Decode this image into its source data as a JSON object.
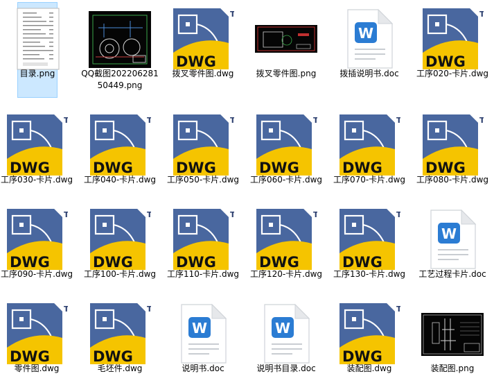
{
  "colors": {
    "background": "#ffffff",
    "selection": "#cce8ff",
    "dwg_navy": "#2b3e6e",
    "dwg_blue": "#4f6fa8",
    "dwg_yellow": "#f5c400",
    "word_blue": "#2b7cd3"
  },
  "dwg_badge": {
    "text": "DWG",
    "tm": "TM"
  },
  "word_badge": {
    "letter": "W"
  },
  "files": [
    {
      "name": "目录.png",
      "icon": "image-thumbnail-icon",
      "kind": "png-doc",
      "selected": true
    },
    {
      "name": "QQ截图20220628150449.png",
      "icon": "image-thumbnail-icon",
      "kind": "png-cad-dark"
    },
    {
      "name": "拨叉零件图.dwg",
      "icon": "dwg-file-icon",
      "kind": "dwg"
    },
    {
      "name": "拨叉零件图.png",
      "icon": "image-thumbnail-icon",
      "kind": "png-cad-small"
    },
    {
      "name": "拨插说明书.doc",
      "icon": "word-doc-icon",
      "kind": "doc"
    },
    {
      "name": "工序020-卡片.dwg",
      "icon": "dwg-file-icon",
      "kind": "dwg"
    },
    {
      "name": "工序030-卡片.dwg",
      "icon": "dwg-file-icon",
      "kind": "dwg"
    },
    {
      "name": "工序040-卡片.dwg",
      "icon": "dwg-file-icon",
      "kind": "dwg"
    },
    {
      "name": "工序050-卡片.dwg",
      "icon": "dwg-file-icon",
      "kind": "dwg"
    },
    {
      "name": "工序060-卡片.dwg",
      "icon": "dwg-file-icon",
      "kind": "dwg"
    },
    {
      "name": "工序070-卡片.dwg",
      "icon": "dwg-file-icon",
      "kind": "dwg"
    },
    {
      "name": "工序080-卡片.dwg",
      "icon": "dwg-file-icon",
      "kind": "dwg"
    },
    {
      "name": "工序090-卡片.dwg",
      "icon": "dwg-file-icon",
      "kind": "dwg"
    },
    {
      "name": "工序100-卡片.dwg",
      "icon": "dwg-file-icon",
      "kind": "dwg"
    },
    {
      "name": "工序110-卡片.dwg",
      "icon": "dwg-file-icon",
      "kind": "dwg"
    },
    {
      "name": "工序120-卡片.dwg",
      "icon": "dwg-file-icon",
      "kind": "dwg"
    },
    {
      "name": "工序130-卡片.dwg",
      "icon": "dwg-file-icon",
      "kind": "dwg"
    },
    {
      "name": "工艺过程卡片.doc",
      "icon": "word-doc-icon",
      "kind": "doc"
    },
    {
      "name": "零件图.dwg",
      "icon": "dwg-file-icon",
      "kind": "dwg"
    },
    {
      "name": "毛坯件.dwg",
      "icon": "dwg-file-icon",
      "kind": "dwg"
    },
    {
      "name": "说明书.doc",
      "icon": "word-doc-icon",
      "kind": "doc"
    },
    {
      "name": "说明书目录.doc",
      "icon": "word-doc-icon",
      "kind": "doc"
    },
    {
      "name": "装配图.dwg",
      "icon": "dwg-file-icon",
      "kind": "dwg"
    },
    {
      "name": "装配图.png",
      "icon": "image-thumbnail-icon",
      "kind": "png-cad-assembly"
    }
  ]
}
